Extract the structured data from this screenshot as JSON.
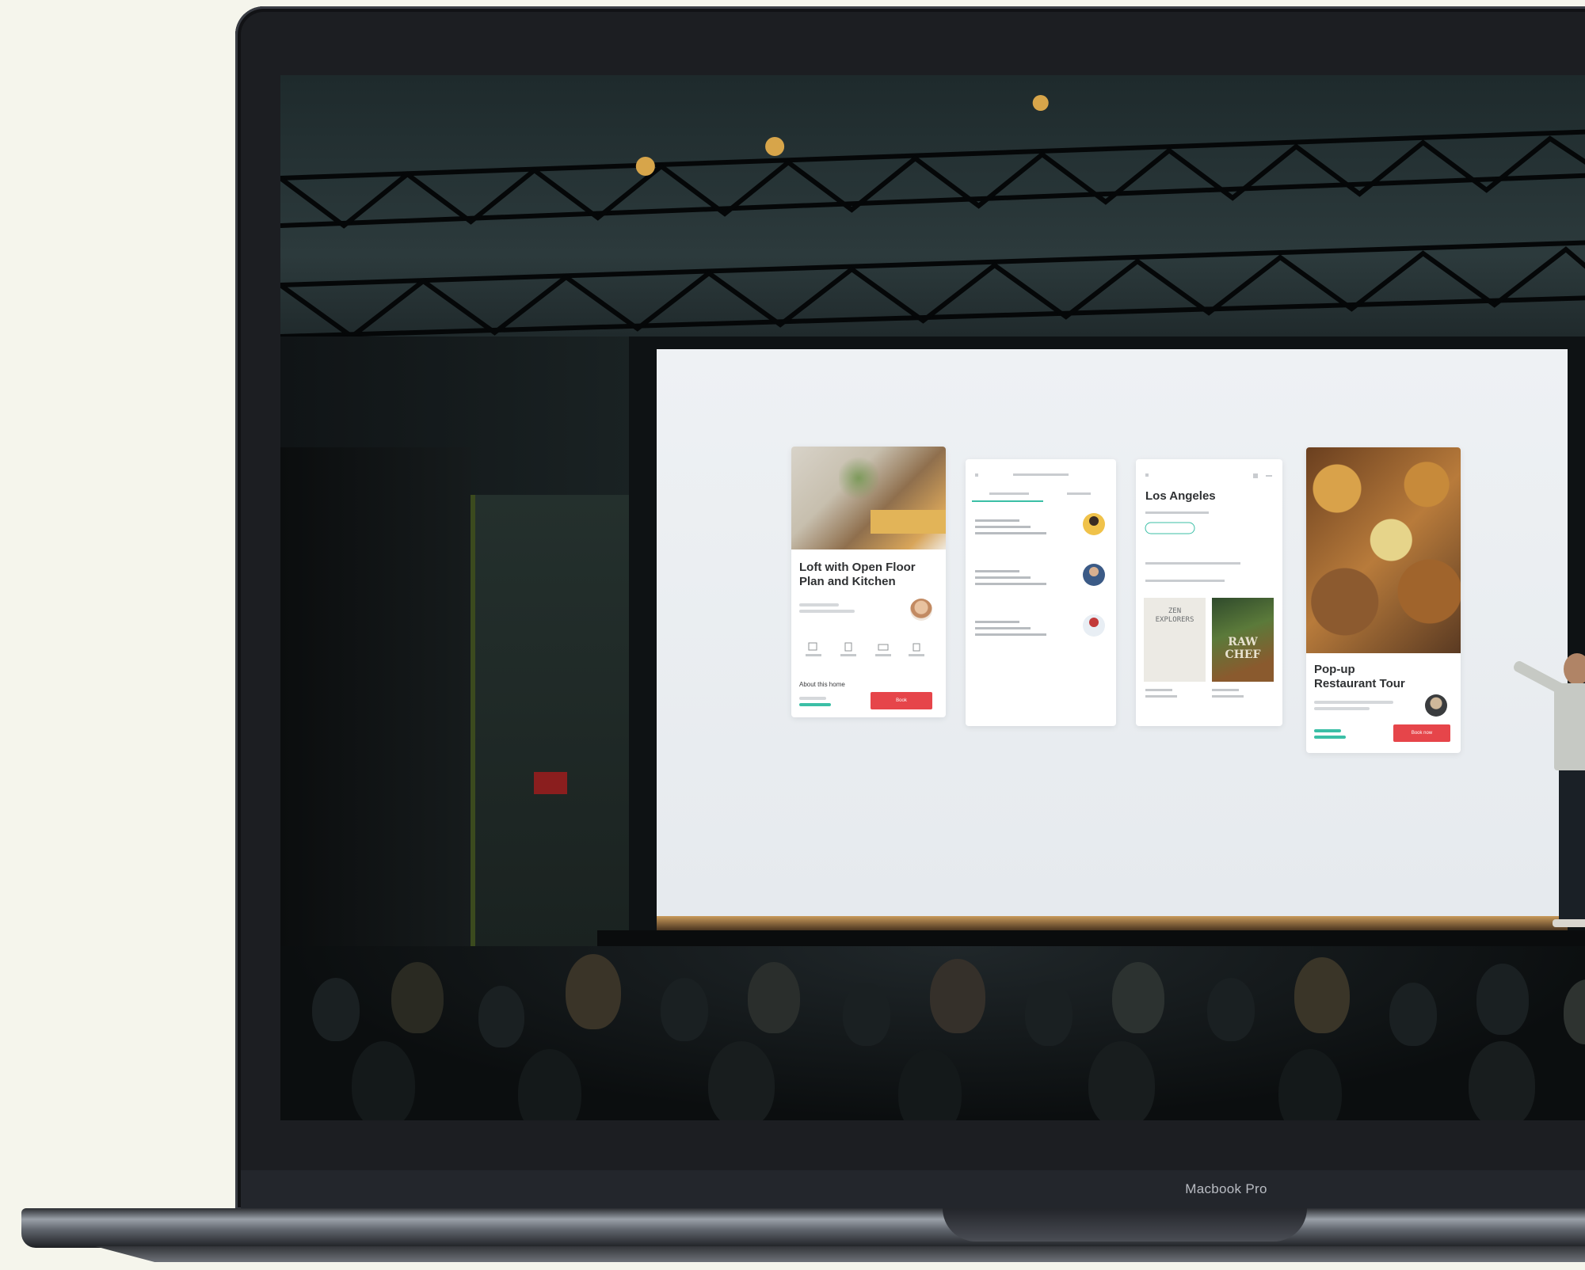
{
  "device": {
    "chin_label": "Macbook Pro"
  },
  "slide": {
    "card_loft": {
      "title": "Loft with Open Floor Plan and Kitchen",
      "section": "About this home",
      "button": "Book"
    },
    "card_city": {
      "title": "Los Angeles"
    },
    "card_books": [
      {
        "cover_text": "ZEN EXPLORERS"
      },
      {
        "cover_text": "RAW CHEF"
      }
    ],
    "card_tour": {
      "title": "Pop-up Restaurant Tour",
      "button": "Book now"
    }
  },
  "colors": {
    "page_bg": "#f5f5ec",
    "accent_red": "#e6454a",
    "accent_teal": "#3bbfa6"
  }
}
